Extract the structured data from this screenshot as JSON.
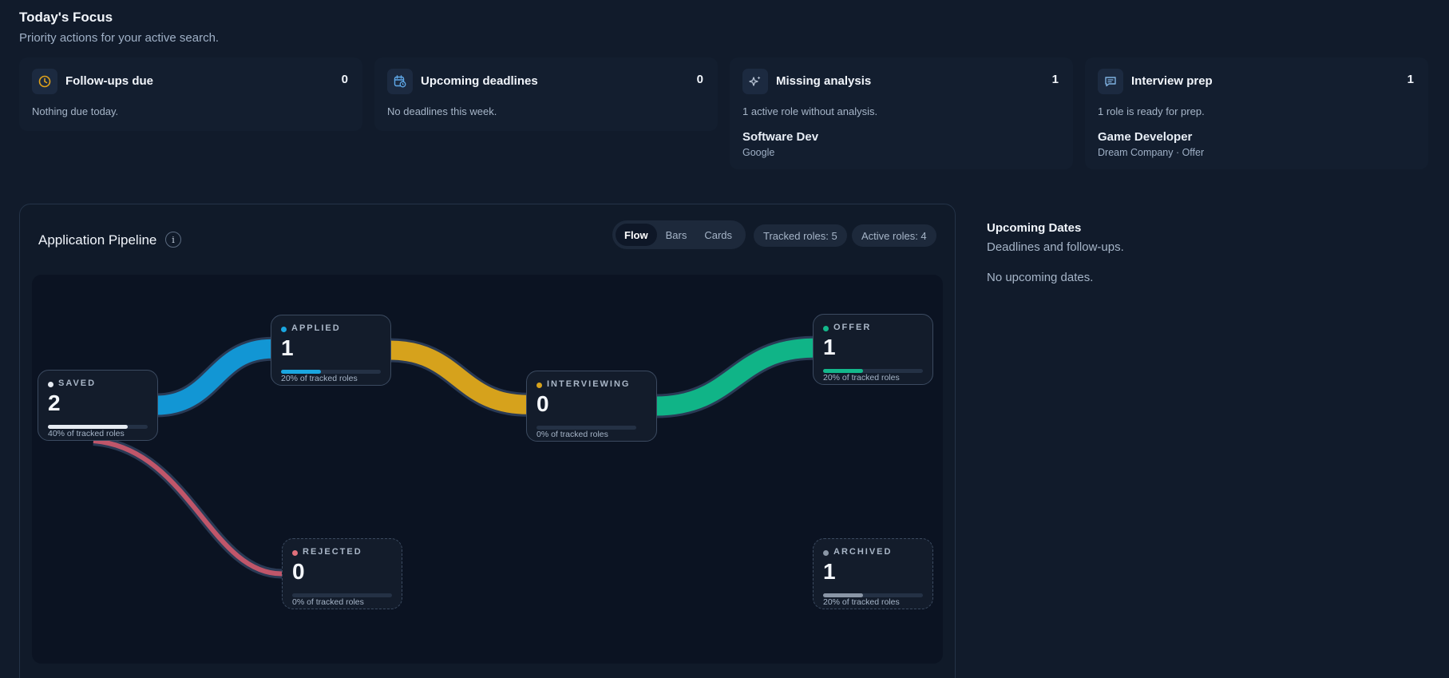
{
  "focus": {
    "title": "Today's Focus",
    "subtitle": "Priority actions for your active search.",
    "cards": [
      {
        "icon": "clock-icon",
        "title": "Follow-ups due",
        "count": "0",
        "text": "Nothing due today.",
        "accent": "#e0a21b"
      },
      {
        "icon": "calendar-clock-icon",
        "title": "Upcoming deadlines",
        "count": "0",
        "text": "No deadlines this week.",
        "accent": "#5fa8e8"
      },
      {
        "icon": "sparkles-icon",
        "title": "Missing analysis",
        "count": "1",
        "text": "1 active role without analysis.",
        "role": "Software Dev",
        "company": "Google",
        "accent": "#b8c4d4"
      },
      {
        "icon": "chat-icon",
        "title": "Interview prep",
        "count": "1",
        "text": "1 role is ready for prep.",
        "role": "Game Developer",
        "company": "Dream Company · Offer",
        "accent": "#7fb1e0"
      }
    ]
  },
  "pipeline": {
    "title": "Application Pipeline",
    "info_icon": "info-icon",
    "view_toggle": {
      "options": [
        "Flow",
        "Bars",
        "Cards"
      ],
      "selected": "Flow"
    },
    "tracked_roles": "Tracked roles: 5",
    "active_roles": "Active roles: 4",
    "stages": [
      {
        "key": "saved",
        "label": "SAVED",
        "count": "2",
        "fraction": 0.4,
        "pct_label": "40% of tracked roles",
        "color": "#e6ebf2",
        "dashed": false
      },
      {
        "key": "applied",
        "label": "APPLIED",
        "count": "1",
        "fraction": 0.2,
        "pct_label": "20% of tracked roles",
        "color": "#1aa6e0",
        "dashed": false
      },
      {
        "key": "interviewing",
        "label": "INTERVIEWING",
        "count": "0",
        "fraction": 0,
        "pct_label": "0% of tracked roles",
        "color": "#d6a21c",
        "dashed": false
      },
      {
        "key": "offer",
        "label": "OFFER",
        "count": "1",
        "fraction": 0.2,
        "pct_label": "20% of tracked roles",
        "color": "#13b88b",
        "dashed": false
      },
      {
        "key": "rejected",
        "label": "REJECTED",
        "count": "0",
        "fraction": 0,
        "pct_label": "0% of tracked roles",
        "color": "#e0707b",
        "dashed": true
      },
      {
        "key": "archived",
        "label": "ARCHIVED",
        "count": "1",
        "fraction": 0.2,
        "pct_label": "20% of tracked roles",
        "color": "#8a96a6",
        "dashed": true
      }
    ],
    "links": [
      {
        "from": "saved",
        "to": "applied",
        "color": "#1296d4"
      },
      {
        "from": "applied",
        "to": "interviewing",
        "color": "#d6a21c"
      },
      {
        "from": "interviewing",
        "to": "offer",
        "color": "#10b487"
      },
      {
        "from": "saved",
        "to": "rejected",
        "color": "#c0566a"
      }
    ]
  },
  "dates": {
    "title": "Upcoming Dates",
    "subtitle": "Deadlines and follow-ups.",
    "empty": "No upcoming dates."
  }
}
